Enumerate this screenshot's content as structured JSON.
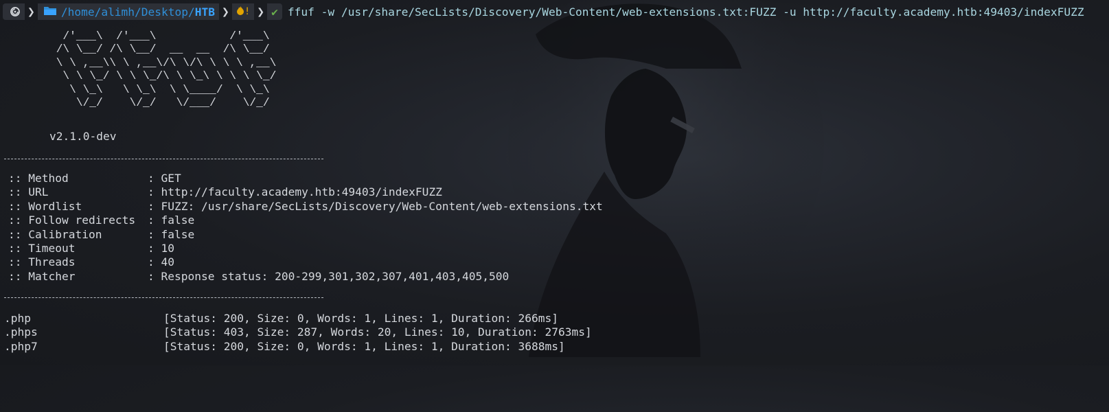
{
  "prompt": {
    "os_icon": "debian-swirl-icon",
    "folder_icon": "folder-icon",
    "path_prefix": "/home/alimh/Desktop/",
    "path_current": "HTB",
    "git_status_icon": "fire-icon",
    "git_status_text": "!",
    "ok_icon": "checkmark-icon",
    "ok_text": "✔",
    "command": "ffuf -w /usr/share/SecLists/Discovery/Web-Content/web-extensions.txt:FUZZ -u http://faculty.academy.htb:49403/indexFUZZ"
  },
  "banner": {
    "ascii": "  /'___\\  /'___\\           /'___\\       \n /\\ \\__/ /\\ \\__/  __  __  /\\ \\__/       \n \\ \\ ,__\\\\ \\ ,__\\/\\ \\/\\ \\ \\ \\ ,__\\      \n  \\ \\ \\_/ \\ \\ \\_/\\ \\ \\_\\ \\ \\ \\ \\_/      \n   \\ \\_\\   \\ \\_\\  \\ \\____/  \\ \\_\\       \n    \\/_/    \\/_/   \\/___/    \\/_/       ",
    "version": "v2.1.0-dev"
  },
  "config": [
    {
      "key": ":: Method",
      "value": ": GET"
    },
    {
      "key": ":: URL",
      "value": ": http://faculty.academy.htb:49403/indexFUZZ"
    },
    {
      "key": ":: Wordlist",
      "value": ": FUZZ: /usr/share/SecLists/Discovery/Web-Content/web-extensions.txt"
    },
    {
      "key": ":: Follow redirects",
      "value": ": false"
    },
    {
      "key": ":: Calibration",
      "value": ": false"
    },
    {
      "key": ":: Timeout",
      "value": ": 10"
    },
    {
      "key": ":: Threads",
      "value": ": 40"
    },
    {
      "key": ":: Matcher",
      "value": ": Response status: 200-299,301,302,307,401,403,405,500"
    }
  ],
  "results": [
    {
      "name": ".php",
      "info": "[Status: 200, Size: 0, Words: 1, Lines: 1, Duration: 266ms]"
    },
    {
      "name": ".phps",
      "info": "[Status: 403, Size: 287, Words: 20, Lines: 10, Duration: 2763ms]"
    },
    {
      "name": ".php7",
      "info": "[Status: 200, Size: 0, Words: 1, Lines: 1, Duration: 3688ms]"
    }
  ],
  "colors": {
    "background": "#1b1d22",
    "path": "#2f8fd8",
    "command": "#a9d6e0",
    "text": "#d5d8dd",
    "ok": "#6ab04c",
    "git": "#e2a400"
  }
}
